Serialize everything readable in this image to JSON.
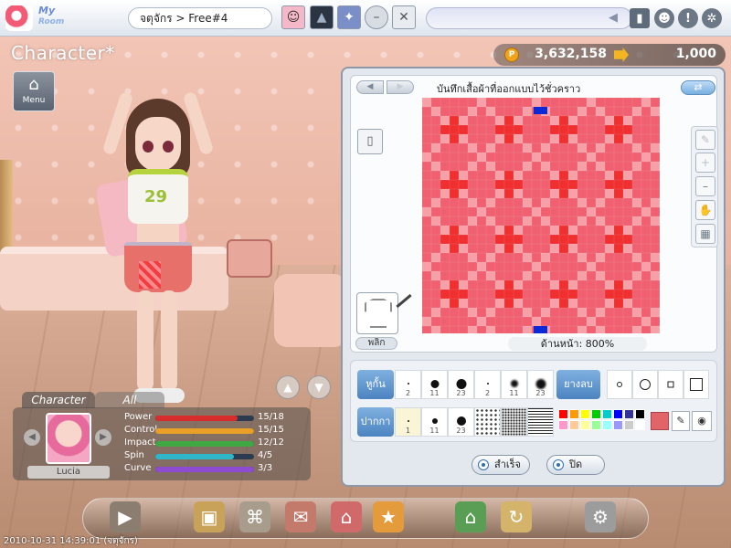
{
  "topbar": {
    "logo_line1": "My",
    "logo_line2": "Room",
    "location": "จตุจักร > Free#4"
  },
  "left": {
    "title": "Character*",
    "menu_label": "Menu"
  },
  "money": {
    "coins": "3,632,158",
    "cash": "1,000"
  },
  "stats": {
    "tab_character": "Character",
    "tab_all": "All",
    "name": "Lucia",
    "rows": [
      {
        "label": "Power",
        "value": "15/18",
        "level": 0.83,
        "color": "#d92c2c"
      },
      {
        "label": "Control",
        "value": "15/15",
        "level": 1.0,
        "color": "#e8a126"
      },
      {
        "label": "Impact",
        "value": "12/12",
        "level": 1.0,
        "color": "#3ea843"
      },
      {
        "label": "Spin",
        "value": "4/5",
        "level": 0.8,
        "color": "#2fb7c9"
      },
      {
        "label": "Curve",
        "value": "3/3",
        "level": 1.0,
        "color": "#8c4bd0"
      }
    ]
  },
  "design": {
    "title": "บันทึกเสื้อผ้าที่ออกแบบไว้ชั่วคราว",
    "flip_label": "พลิก",
    "view_label": "ด้านหน้า: 800%",
    "brush_label": "หูกั้น",
    "pattern_label": "ปากกา",
    "eraser_label": "ยางลบ",
    "brush_sizes": [
      "2",
      "11",
      "23",
      "2",
      "11",
      "23"
    ],
    "pattern_sizes": [
      "1",
      "11",
      "23"
    ],
    "complete_label": "สำเร็จ",
    "close_label": "ปิด",
    "current_color": "#e06468",
    "palette": [
      "#ff0000",
      "#ff9900",
      "#ffff00",
      "#00cc00",
      "#00cccc",
      "#0000ff",
      "#333399",
      "#000000",
      "#ff99cc",
      "#ffcc99",
      "#ffff99",
      "#99ff99",
      "#99ffff",
      "#9999ff",
      "#cccccc",
      "#ffffff"
    ],
    "grid_colors": {
      "base": "#f06070",
      "light": "#f7a0a8",
      "dark": "#f03030",
      "marker": "#0a2ad8"
    }
  },
  "footer": {
    "timestamp": "2010-10-31 14:39:01 (จตุจักร)"
  }
}
